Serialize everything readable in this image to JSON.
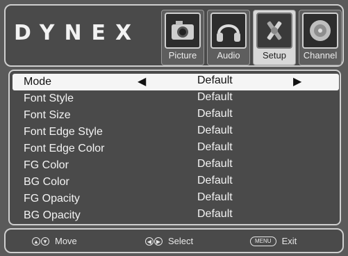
{
  "brand": {
    "logo_text": "DYNEX"
  },
  "tabs": [
    {
      "label": "Picture",
      "icon": "camera-icon",
      "active": false
    },
    {
      "label": "Audio",
      "icon": "headphones-icon",
      "active": false
    },
    {
      "label": "Setup",
      "icon": "tools-icon",
      "active": true
    },
    {
      "label": "Channel",
      "icon": "satellite-dish-icon",
      "active": false
    }
  ],
  "settings": {
    "rows": [
      {
        "label": "Mode",
        "value": "Default",
        "selected": true
      },
      {
        "label": "Font Style",
        "value": "Default"
      },
      {
        "label": "Font Size",
        "value": "Default"
      },
      {
        "label": "Font Edge Style",
        "value": "Default"
      },
      {
        "label": "Font Edge Color",
        "value": "Default"
      },
      {
        "label": "FG Color",
        "value": "Default"
      },
      {
        "label": "BG Color",
        "value": "Default"
      },
      {
        "label": "FG Opacity",
        "value": "Default"
      },
      {
        "label": "BG Opacity",
        "value": "Default"
      }
    ],
    "left_arrow": "◀",
    "right_arrow": "▶"
  },
  "hints": {
    "move_label": "Move",
    "select_label": "Select",
    "menu_key": "MENU",
    "exit_label": "Exit"
  },
  "colors": {
    "panel": "#4a4a4a",
    "highlight": "#f5f5f5",
    "text": "#f3f3f3"
  }
}
